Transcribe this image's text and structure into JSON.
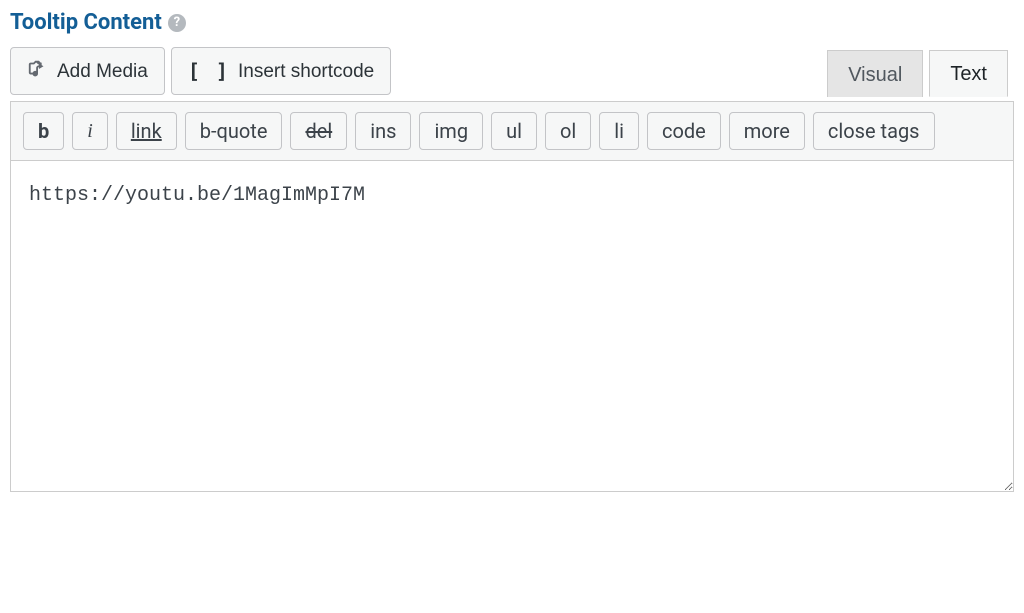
{
  "section": {
    "title": "Tooltip Content"
  },
  "media_buttons": {
    "add_media": "Add Media",
    "insert_shortcode": "Insert shortcode"
  },
  "editor_tabs": {
    "visual": "Visual",
    "text": "Text"
  },
  "quicktags": {
    "b": "b",
    "i": "i",
    "link": "link",
    "bquote": "b-quote",
    "del": "del",
    "ins": "ins",
    "img": "img",
    "ul": "ul",
    "ol": "ol",
    "li": "li",
    "code": "code",
    "more": "more",
    "close_tags": "close tags"
  },
  "editor": {
    "content": "https://youtu.be/1MagImMpI7M"
  }
}
